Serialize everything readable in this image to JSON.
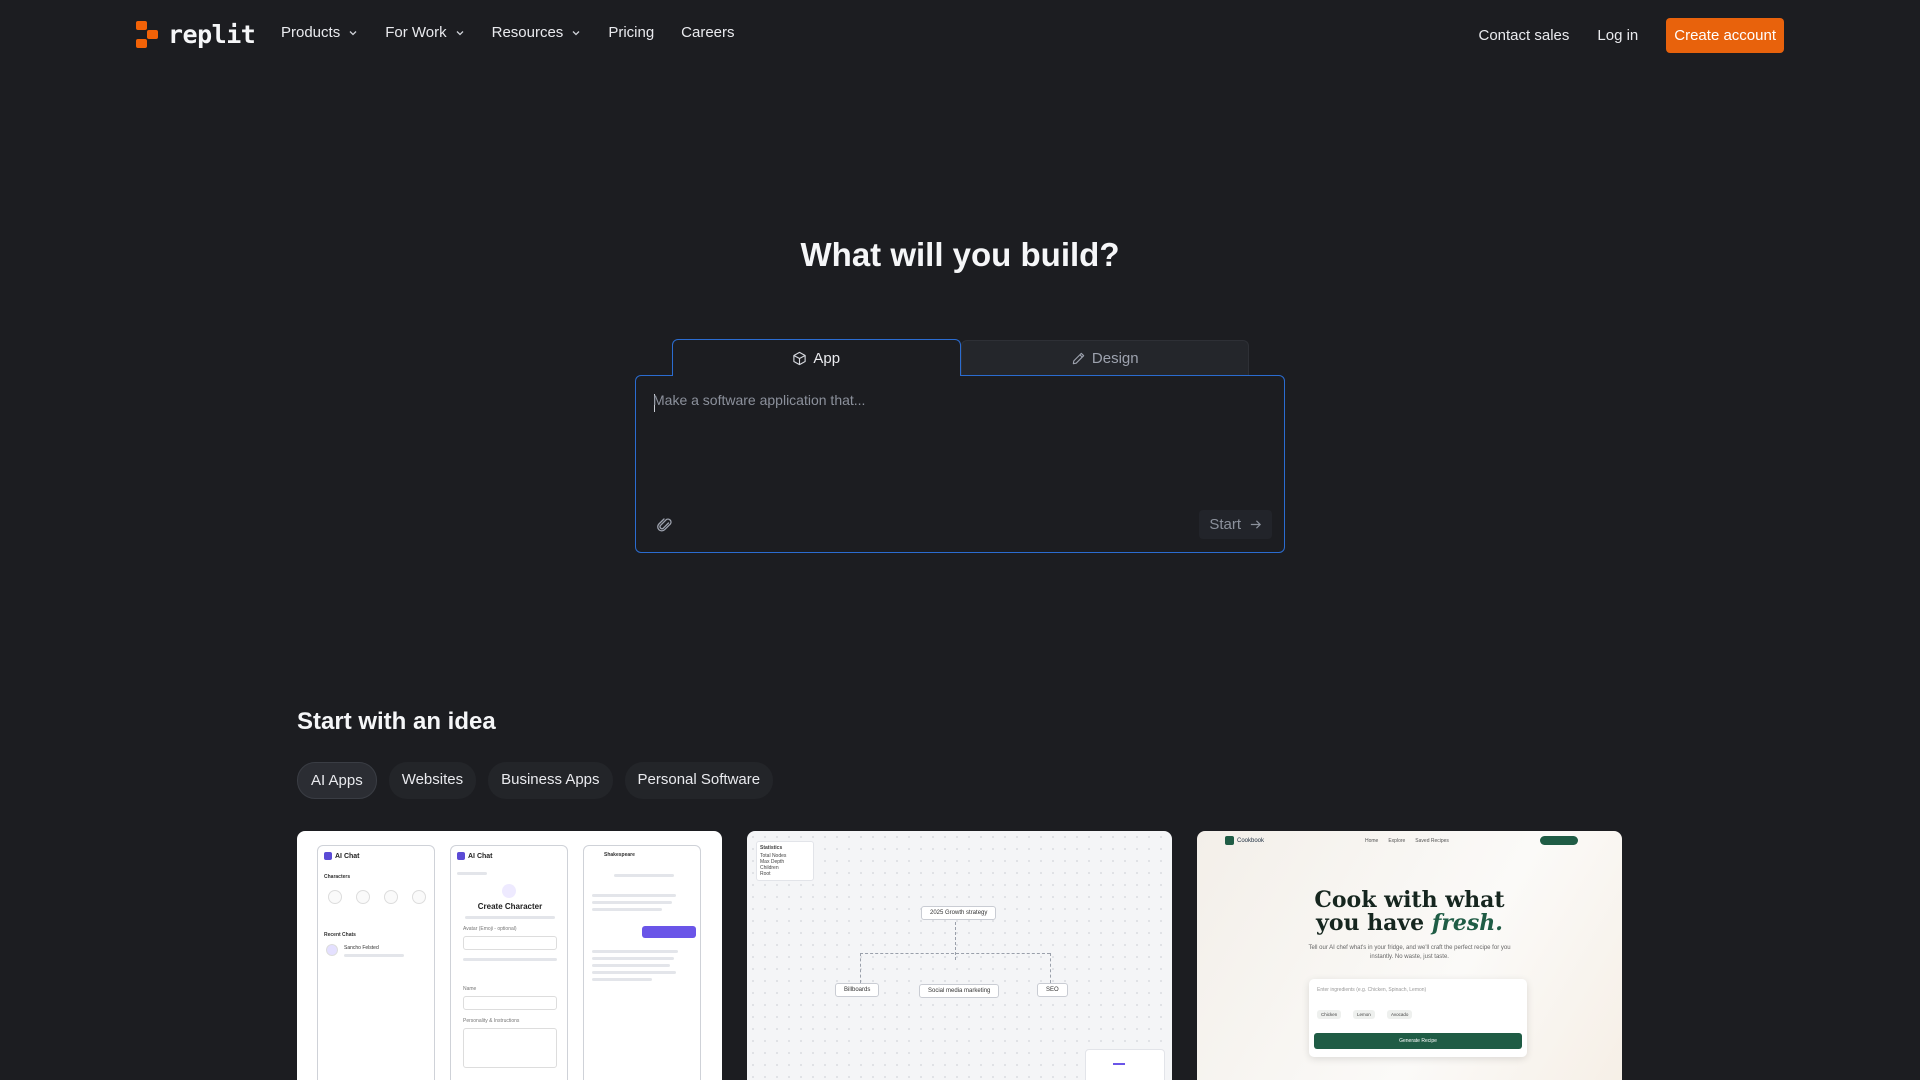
{
  "brand": {
    "name": "replit",
    "color": "#f26207"
  },
  "nav": {
    "items": [
      {
        "label": "Products",
        "has_dropdown": true
      },
      {
        "label": "For Work",
        "has_dropdown": true
      },
      {
        "label": "Resources",
        "has_dropdown": true
      },
      {
        "label": "Pricing",
        "has_dropdown": false
      },
      {
        "label": "Careers",
        "has_dropdown": false
      }
    ],
    "contact_sales": "Contact sales",
    "login": "Log in",
    "create_account": "Create account"
  },
  "hero": {
    "title": "What will you build?",
    "tabs": [
      {
        "label": "App",
        "icon": "cube-icon",
        "active": true
      },
      {
        "label": "Design",
        "icon": "pencil-icon",
        "active": false
      }
    ],
    "prompt_placeholder": "Make a software application that...",
    "start_label": "Start"
  },
  "ideas": {
    "title": "Start with an idea",
    "categories": [
      {
        "label": "AI Apps",
        "active": true
      },
      {
        "label": "Websites",
        "active": false
      },
      {
        "label": "Business Apps",
        "active": false
      },
      {
        "label": "Personal Software",
        "active": false
      }
    ],
    "cards": [
      {
        "screens": [
          {
            "title": "AI Chat",
            "heading": "Characters",
            "recent": "Recent Chats",
            "chat_name": "Sancho Felsted"
          },
          {
            "title": "AI Chat",
            "heading": "Create Character",
            "field1": "Avatar (Emoji - optional)",
            "field2": "Name",
            "field3": "Personality & Instructions"
          },
          {
            "title": "Shakespeare",
            "reply": "Hail! Good morrow!"
          }
        ]
      },
      {
        "legend": {
          "title": "Statistics",
          "rows": [
            "Total Nodes",
            "Max Depth",
            "Children",
            "Root"
          ]
        },
        "nodes": {
          "root": "2025 Growth strategy",
          "left": "Billboards",
          "middle": "Social media marketing",
          "right": "SEO"
        }
      },
      {
        "brand": "Cookbook",
        "links": [
          "Home",
          "Explore",
          "Saved Recipes"
        ],
        "headline_1": "Cook with what",
        "headline_2": "you have",
        "headline_em": "fresh.",
        "subtitle": "Tell our AI chef what's in your fridge, and we'll craft the perfect recipe for you instantly. No waste, just taste.",
        "input_placeholder": "Enter ingredients (e.g. Chicken, Spinach, Lemon)",
        "tags": [
          "Chicken",
          "Lemon",
          "Avocado"
        ],
        "generate_label": "Generate Recipe"
      }
    ]
  }
}
